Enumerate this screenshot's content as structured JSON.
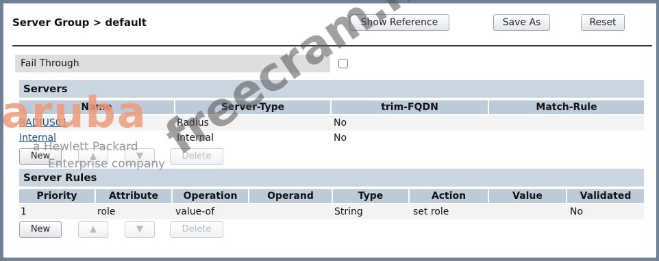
{
  "header": {
    "title": "Server Group > default",
    "show_reference": "Show Reference",
    "save_as": "Save As",
    "reset": "Reset"
  },
  "fail_through": {
    "label": "Fail Through",
    "checked": false
  },
  "servers": {
    "heading": "Servers",
    "columns": [
      "Name",
      "Server-Type",
      "trim-FQDN",
      "Match-Rule"
    ],
    "rows": [
      {
        "name": "RADIUS01",
        "type": "Radius",
        "trim": "No",
        "match": ""
      },
      {
        "name": "Internal",
        "type": "Internal",
        "trim": "No",
        "match": ""
      }
    ],
    "buttons": {
      "new": "New",
      "up": "▲",
      "down": "▼",
      "delete": "Delete"
    }
  },
  "server_rules": {
    "heading": "Server Rules",
    "columns": [
      "Priority",
      "Attribute",
      "Operation",
      "Operand",
      "Type",
      "Action",
      "Value",
      "Validated"
    ],
    "rows": [
      {
        "priority": "1",
        "attribute": "role",
        "operation": "value-of",
        "operand": "",
        "type": "String",
        "action": "set role",
        "value": "",
        "validated": "No"
      }
    ],
    "buttons": {
      "new": "New",
      "up": "▲",
      "down": "▼",
      "delete": "Delete"
    }
  },
  "watermarks": {
    "brand": "aruba",
    "sub1": "a Hewlett Packard",
    "sub2": "Enterprise company",
    "site": "freecram.net"
  }
}
